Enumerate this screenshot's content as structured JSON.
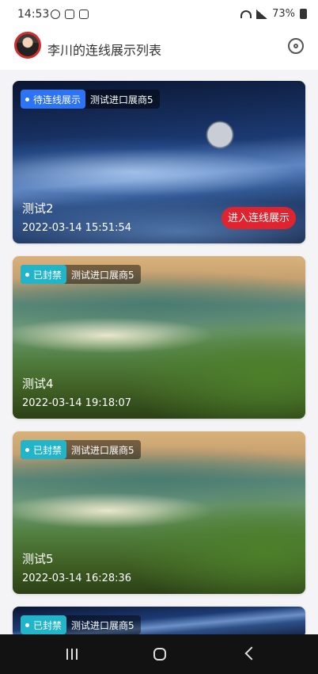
{
  "status_bar": {
    "time": "14:53",
    "battery_percent": "73%"
  },
  "header": {
    "title": "李川的连线展示列表"
  },
  "cards": [
    {
      "status": "待连线展示",
      "status_color": "#2d73f5",
      "company": "测试进口展商5",
      "name": "测试2",
      "datetime": "2022-03-14 15:51:54",
      "action_label": "进入连线展示",
      "background": "space"
    },
    {
      "status": "已封禁",
      "status_color": "#22b5c9",
      "company": "测试进口展商5",
      "name": "测试4",
      "datetime": "2022-03-14 19:18:07",
      "background": "landscape"
    },
    {
      "status": "已封禁",
      "status_color": "#22b5c9",
      "company": "测试进口展商5",
      "name": "测试5",
      "datetime": "2022-03-14 16:28:36",
      "background": "landscape"
    },
    {
      "status": "已封禁",
      "status_color": "#22b5c9",
      "company": "测试进口展商5",
      "background": "space"
    }
  ],
  "icons": {
    "settings": "gear-icon",
    "avatar": "avatar",
    "nav": [
      "recent-apps-icon",
      "home-icon",
      "back-icon"
    ]
  }
}
